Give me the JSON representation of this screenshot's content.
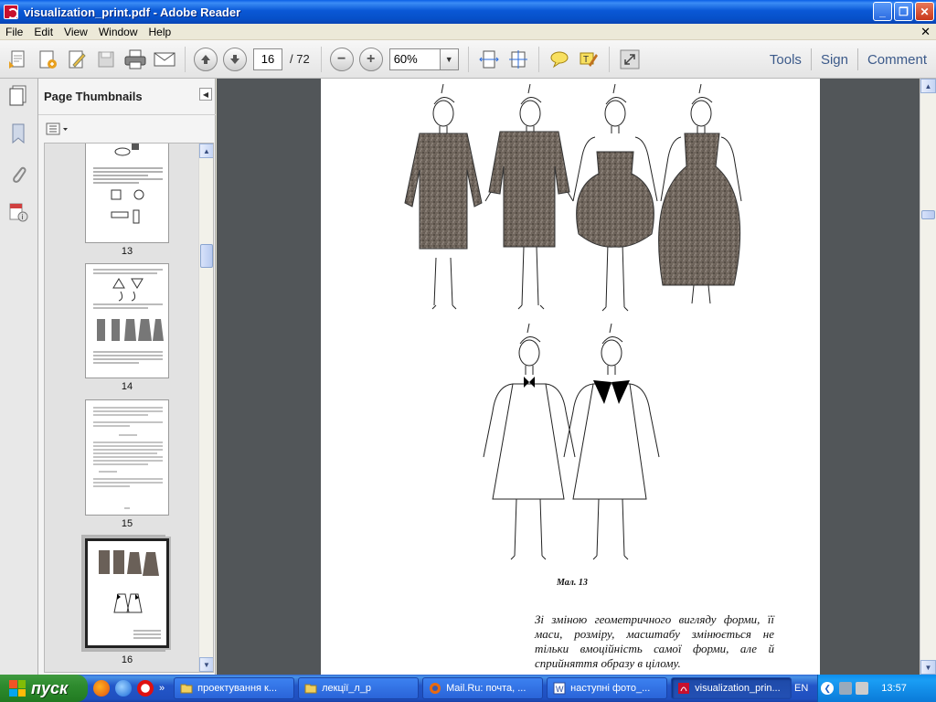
{
  "window": {
    "title": "visualization_print.pdf - Adobe Reader",
    "minimize": "_",
    "maximize": "❐",
    "close": "✕"
  },
  "menu": {
    "items": [
      "File",
      "Edit",
      "View",
      "Window",
      "Help"
    ],
    "close_doc": "✕"
  },
  "toolbar": {
    "page_current": "16",
    "page_total": "/ 72",
    "zoom": "60%",
    "zoom_out": "−",
    "zoom_in": "+",
    "tools": "Tools",
    "sign": "Sign",
    "comment": "Comment"
  },
  "thumbnails": {
    "title": "Page Thumbnails",
    "pages": [
      {
        "label": "13"
      },
      {
        "label": "14"
      },
      {
        "label": "15"
      },
      {
        "label": "16"
      }
    ],
    "selected_page": "16"
  },
  "document": {
    "figure_caption": "Мал. 13",
    "body_text": "Зі зміною геометричного вигляду форми, її маси, розміру, масштабу змінюється не тільки вмоційність самої форми, але й сприйняття образу в цілому."
  },
  "taskbar": {
    "start_label": "пуск",
    "tasks": [
      {
        "label": "проектування к...",
        "icon": "folder-icon",
        "active": false
      },
      {
        "label": "лекції_л_р",
        "icon": "folder-icon",
        "active": false
      },
      {
        "label": "Mail.Ru: почта, ...",
        "icon": "firefox-icon",
        "active": false
      },
      {
        "label": "наступні фото_...",
        "icon": "word-icon",
        "active": false
      },
      {
        "label": "visualization_prin...",
        "icon": "pdf-icon",
        "active": true
      }
    ],
    "language": "EN",
    "clock": "13:57"
  },
  "colors": {
    "titlebar_blue": "#0a58d6",
    "doc_background": "#525659",
    "dress_fabric": "#6f655c",
    "taskbar_blue": "#2356c8",
    "start_green": "#2e8b2e"
  }
}
